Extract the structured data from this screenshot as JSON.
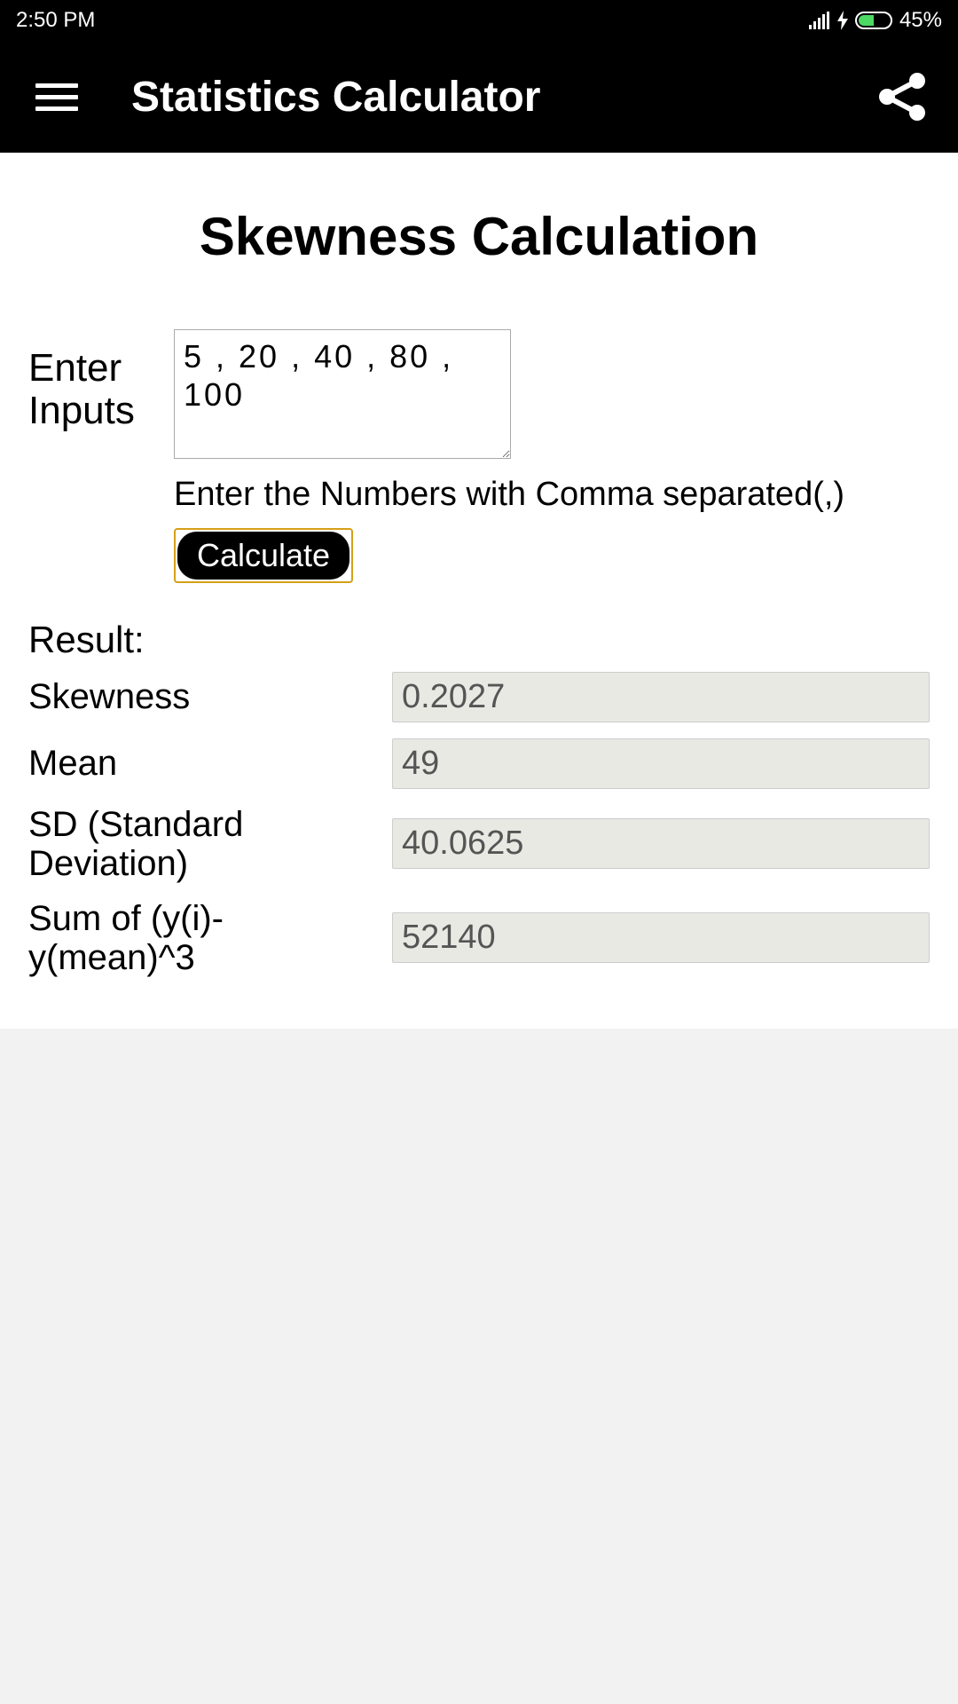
{
  "status": {
    "time": "2:50 PM",
    "battery_percent": "45%"
  },
  "header": {
    "title": "Statistics Calculator"
  },
  "page": {
    "title": "Skewness Calculation",
    "input_label": "Enter Inputs",
    "input_value": "5 , 20 , 40 , 80 , 100",
    "hint": "Enter the Numbers with Comma separated(,)",
    "calculate_label": "Calculate",
    "result_label": "Result:",
    "results": {
      "skewness_label": "Skewness",
      "skewness_value": "0.2027",
      "mean_label": "Mean",
      "mean_value": "49",
      "sd_label": "SD (Standard Deviation)",
      "sd_value": "40.0625",
      "sumcube_label": "Sum of (y(i)-y(mean)^3",
      "sumcube_value": "52140"
    }
  }
}
